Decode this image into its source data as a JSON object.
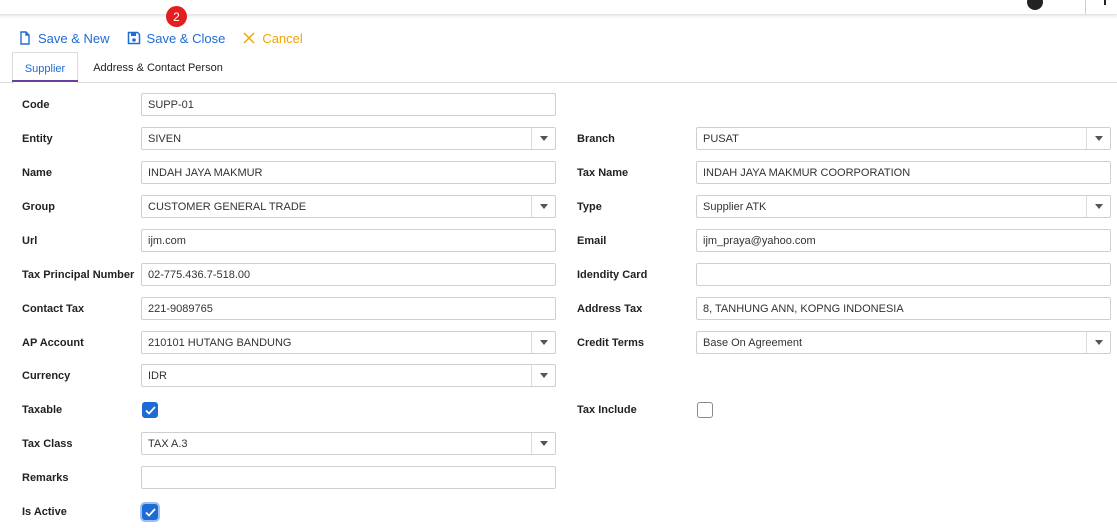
{
  "toolbar": {
    "save_new": "Save & New",
    "save_close": "Save & Close",
    "cancel": "Cancel",
    "badge": "2"
  },
  "tabs": [
    "Supplier",
    "Address & Contact Person"
  ],
  "form": {
    "code": {
      "label": "Code",
      "value": "SUPP-01"
    },
    "entity": {
      "label": "Entity",
      "value": "SIVEN"
    },
    "branch": {
      "label": "Branch",
      "value": "PUSAT"
    },
    "name": {
      "label": "Name",
      "value": "INDAH JAYA MAKMUR"
    },
    "tax_name": {
      "label": "Tax Name",
      "value": "INDAH JAYA MAKMUR COORPORATION"
    },
    "group": {
      "label": "Group",
      "value": "CUSTOMER GENERAL TRADE"
    },
    "type": {
      "label": "Type",
      "value": "Supplier ATK"
    },
    "url": {
      "label": "Url",
      "value": "ijm.com"
    },
    "email": {
      "label": "Email",
      "value": "ijm_praya@yahoo.com"
    },
    "tax_principal": {
      "label": "Tax Principal Number",
      "value": "02-775.436.7-518.00"
    },
    "identity_card": {
      "label": "Idendity Card",
      "value": ""
    },
    "contact_tax": {
      "label": "Contact Tax",
      "value": "221-9089765"
    },
    "address_tax": {
      "label": "Address Tax",
      "value": "8, TANHUNG ANN, KOPNG INDONESIA"
    },
    "ap_account": {
      "label": "AP Account",
      "value": "210101 HUTANG BANDUNG"
    },
    "credit_terms": {
      "label": "Credit Terms",
      "value": "Base On Agreement"
    },
    "currency": {
      "label": "Currency",
      "value": "IDR"
    },
    "taxable": {
      "label": "Taxable",
      "checked": true
    },
    "tax_include": {
      "label": "Tax Include",
      "checked": false
    },
    "tax_class": {
      "label": "Tax Class",
      "value": "TAX A.3"
    },
    "remarks": {
      "label": "Remarks",
      "value": ""
    },
    "is_active": {
      "label": "Is Active",
      "checked": true
    }
  },
  "colors": {
    "accent": "#1e6bd6",
    "cancel": "#f0a500",
    "badge": "#e21f1f",
    "tab_underline": "#6a3ea1"
  }
}
